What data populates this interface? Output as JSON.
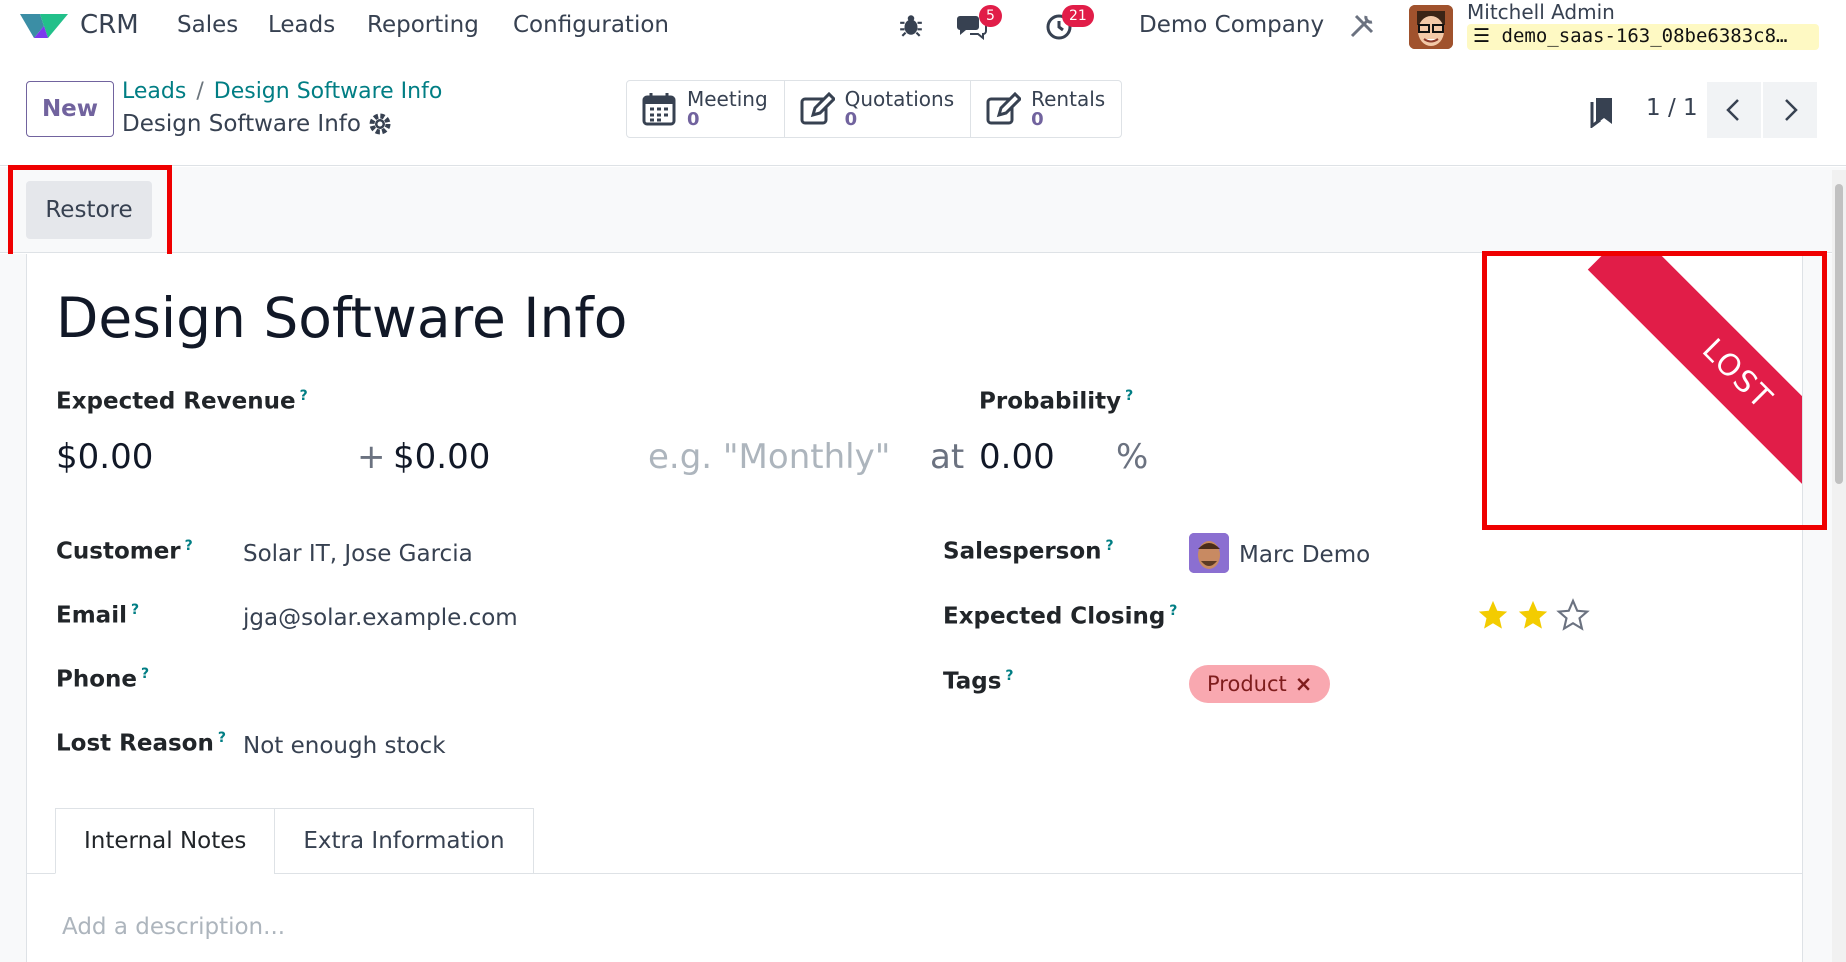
{
  "navbar": {
    "app_name": "CRM",
    "menu": [
      "Sales",
      "Leads",
      "Reporting",
      "Configuration"
    ],
    "messages_badge": "5",
    "activities_badge": "21",
    "company": "Demo Company",
    "user_name": "Mitchell Admin",
    "database": "demo_saas-163_08be6383c8…"
  },
  "control_panel": {
    "new_label": "New",
    "breadcrumb": [
      "Leads",
      "Design Software Info"
    ],
    "record_title": "Design Software Info",
    "smart_buttons": [
      {
        "label": "Meeting",
        "value": "0"
      },
      {
        "label": "Quotations",
        "value": "0"
      },
      {
        "label": "Rentals",
        "value": "0"
      }
    ],
    "pager": "1 / 1"
  },
  "status_bar": {
    "restore_label": "Restore"
  },
  "form": {
    "title": "Design Software Info",
    "ribbon": "LOST",
    "expected_revenue_label": "Expected Revenue",
    "expected_revenue": "$0.00",
    "plus": "+",
    "recurring_revenue": "$0.00",
    "recurring_placeholder": "e.g. \"Monthly\"",
    "at": "at",
    "probability_label": "Probability",
    "probability": "0.00",
    "percent": "%",
    "customer_label": "Customer",
    "customer": "Solar IT, Jose Garcia",
    "email_label": "Email",
    "email": "jga@solar.example.com",
    "phone_label": "Phone",
    "phone": "",
    "lost_reason_label": "Lost Reason",
    "lost_reason": "Not enough stock",
    "salesperson_label": "Salesperson",
    "salesperson": "Marc Demo",
    "expected_closing_label": "Expected Closing",
    "priority_stars": 2,
    "priority_max": 3,
    "tags_label": "Tags",
    "tags": [
      "Product"
    ],
    "help_mark": "?",
    "tabs": [
      "Internal Notes",
      "Extra Information"
    ],
    "description_placeholder": "Add a description..."
  },
  "colors": {
    "brand": "#71639e",
    "link": "#017e84",
    "ribbon": "#e11d48",
    "highlight": "#ef0000",
    "star": "#f3cc00"
  }
}
